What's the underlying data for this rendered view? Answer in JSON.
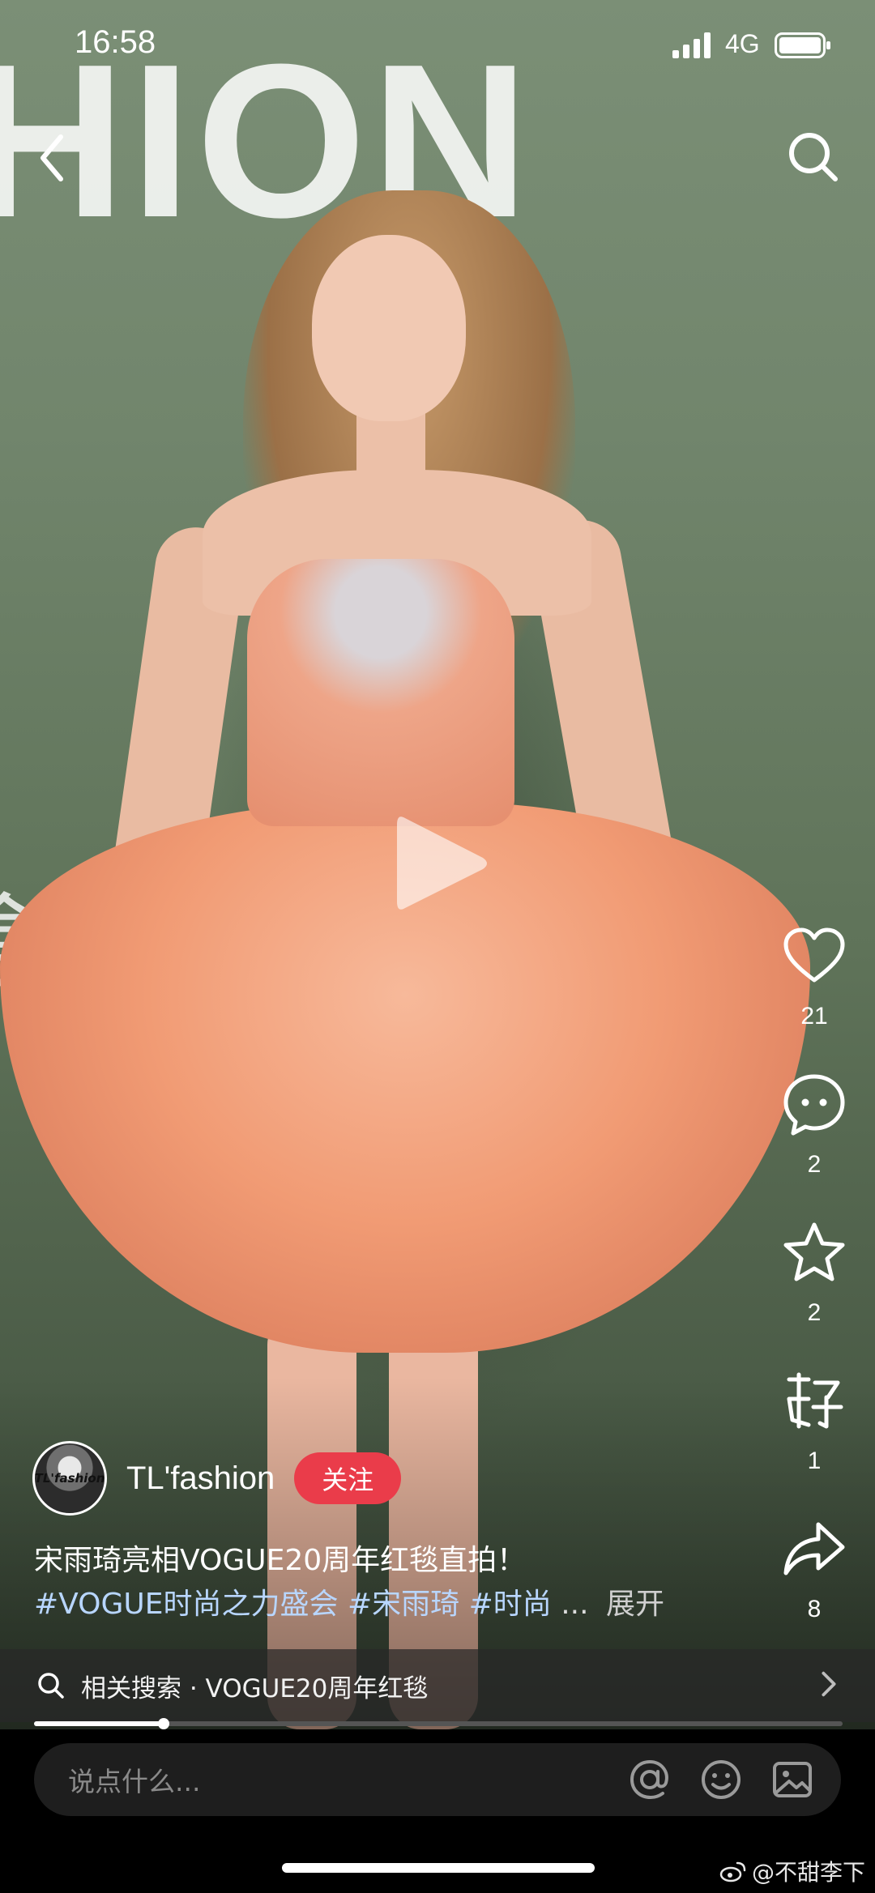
{
  "status_bar": {
    "time": "16:58",
    "network": "4G"
  },
  "video": {
    "background_text": "HION",
    "background_hanzi": "盒",
    "progress_percent": 16
  },
  "actions": {
    "like_count": "21",
    "comment_count": "2",
    "favorite_count": "2",
    "good_count": "1",
    "share_count": "8"
  },
  "author": {
    "avatar_text": "TL'fashion",
    "name": "TL'fashion",
    "follow_label": "关注"
  },
  "caption": {
    "text": "宋雨琦亮相VOGUE20周年红毯直拍！",
    "tags": [
      "#VOGUE时尚之力盛会",
      "#宋雨琦",
      "#时尚"
    ],
    "ellipsis": "...",
    "expand_label": "展开"
  },
  "related_search": {
    "text": "相关搜索 · VOGUE20周年红毯"
  },
  "comment_bar": {
    "placeholder": "说点什么..."
  },
  "watermark": {
    "text": "@不甜李下"
  },
  "colors": {
    "follow": "#ea3c4a",
    "tag": "#b8d6ff",
    "background": "#000000"
  },
  "icons": [
    "back-icon",
    "search-icon",
    "play-icon",
    "heart-icon",
    "comment-icon",
    "star-icon",
    "good-icon",
    "share-icon",
    "at-icon",
    "emoji-icon",
    "image-icon",
    "chevron-right-icon"
  ]
}
